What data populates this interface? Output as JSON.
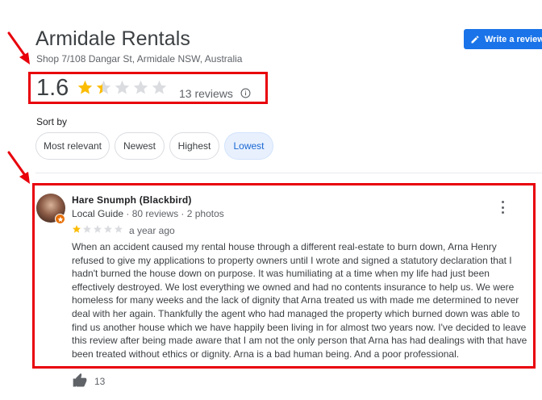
{
  "business": {
    "name": "Armidale Rentals",
    "address": "Shop 7/108 Dangar St, Armidale NSW, Australia"
  },
  "write_review": {
    "label": "Write a review",
    "icon": "pencil-icon",
    "color": "#1a73e8"
  },
  "rating": {
    "value": "1.6",
    "stars_filled_fraction": 0.32,
    "count_label": "13 reviews",
    "star_color": "#fbbc04"
  },
  "sort": {
    "label": "Sort by",
    "options": [
      "Most relevant",
      "Newest",
      "Highest",
      "Lowest"
    ],
    "selected": "Lowest"
  },
  "review": {
    "author": "Hare Snumph (Blackbird)",
    "guide_label": "Local Guide",
    "meta": " · 80 reviews · 2 photos",
    "stars": 1,
    "time": "a year ago",
    "text": "When an accident caused my rental house through a different real-estate to burn down, Arna Henry refused to give my applications to property owners until I wrote and signed a statutory declaration that I hadn't burned the house down on purpose. It was humiliating at a time when my life had just been effectively destroyed. We lost everything we owned and had no contents insurance to help us. We were homeless for many weeks and the lack of dignity that Arna treated us with made me determined to never deal with her again. Thankfully the agent who had managed the property which burned down was able to find us another house which we have happily been living in for almost two years now. I've decided to leave this review after being made aware that I am not the only person that Arna has had dealings with that have been treated without ethics or dignity. Arna is a bad human being. And a poor professional.",
    "likes": "13"
  },
  "annotation_color": "#e8000b"
}
